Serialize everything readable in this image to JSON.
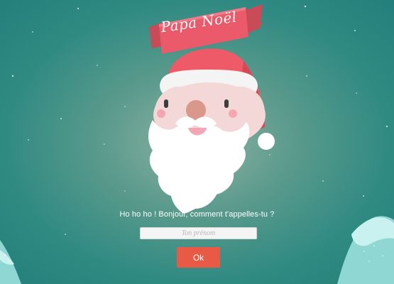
{
  "app": {
    "title": "Papa Noël"
  },
  "greeting": {
    "text": "Ho ho ho ! Bonjour, comment t'appelles-tu ?"
  },
  "form": {
    "name_placeholder": "Ton prénom",
    "name_value": "",
    "submit_label": "Ok"
  },
  "icons": {
    "banner": "ribbon-banner",
    "santa": "santa-face-icon",
    "stars": "stars-decoration",
    "hills": "snowy-hill-decoration"
  },
  "colors": {
    "accent": "#e85a46",
    "banner": "#ea5a6a",
    "hat": "#ef5a68",
    "beard": "#ffffff",
    "background_center": "#8fb3a3",
    "background_edge": "#237f7b",
    "hill": "#8fd7d3"
  }
}
